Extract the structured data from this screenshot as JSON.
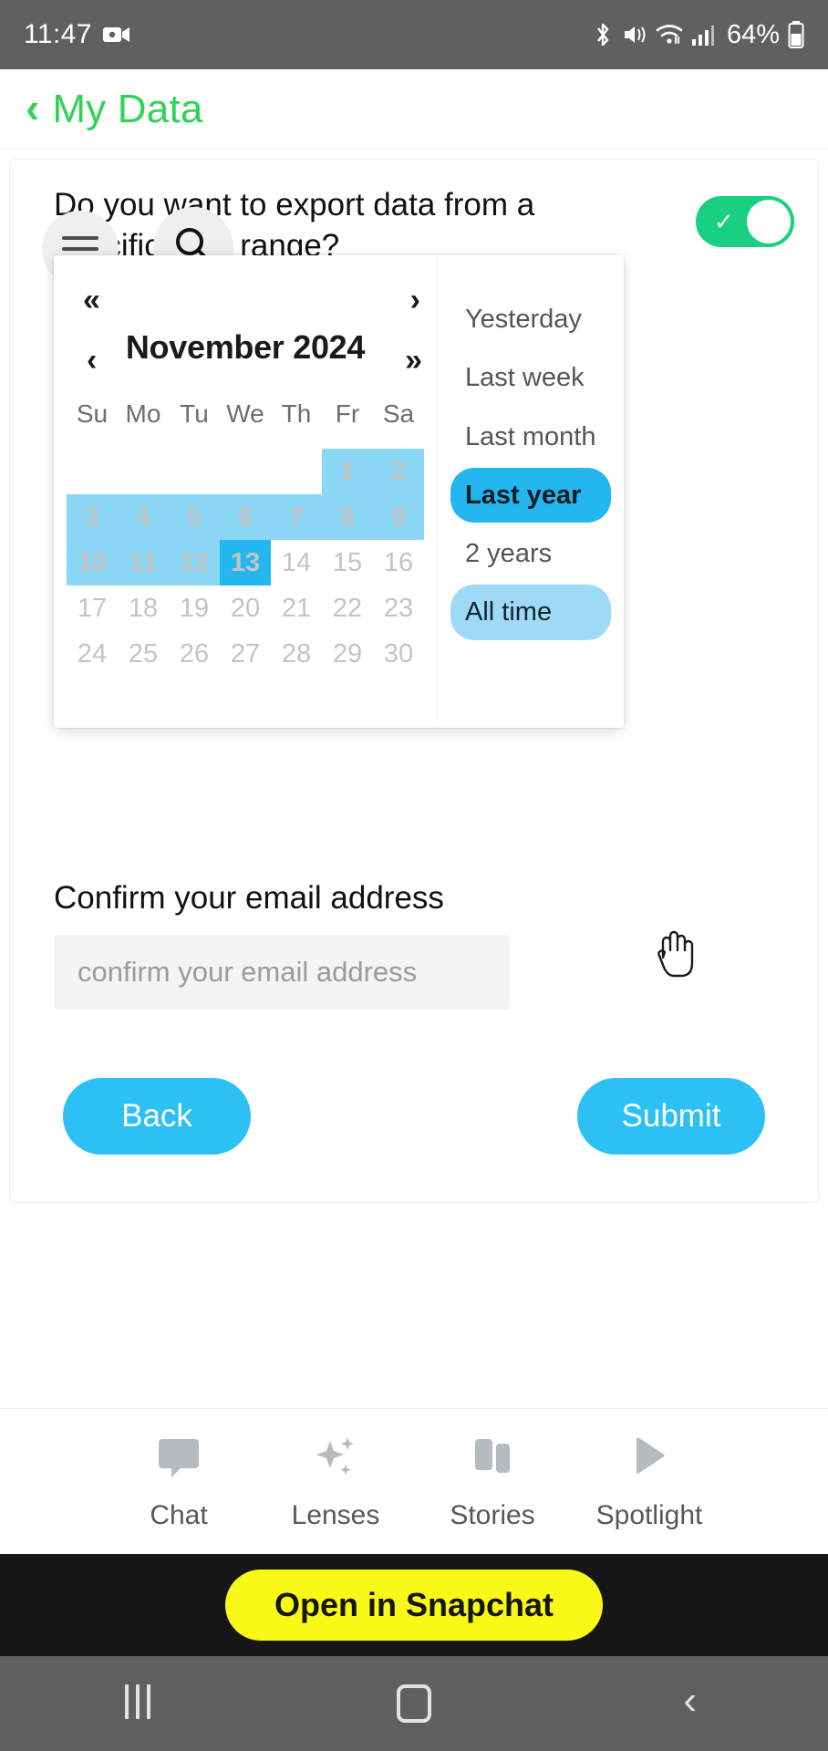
{
  "status_bar": {
    "time": "11:47",
    "battery_percent": "64%",
    "icons": [
      "screen-recorder-icon",
      "bluetooth-icon",
      "mute-icon",
      "wifi-icon",
      "cellular-signal-icon",
      "battery-icon"
    ]
  },
  "titlebar": {
    "back_label": "‹",
    "title": "My Data",
    "accent_color": "#2fd455"
  },
  "overlay_buttons": {
    "menu": "menu-icon",
    "search": "search-icon"
  },
  "form": {
    "question": "Do you want to export data from a specific date range?",
    "toggle_on": true,
    "toggle_color": "#18d07f",
    "email_label": "Confirm your email address",
    "email_value": "",
    "email_placeholder": "confirm your email address",
    "back_label": "Back",
    "submit_label": "Submit",
    "button_color": "#2cc0f5"
  },
  "datepicker": {
    "title": "November 2024",
    "nav": {
      "prev_year": "«",
      "prev_month": "‹",
      "next_month": "›",
      "next_year": "»"
    },
    "weekdays": [
      "Su",
      "Mo",
      "Tu",
      "We",
      "Th",
      "Fr",
      "Sa"
    ],
    "weeks": [
      [
        {
          "day": "",
          "state": "empty"
        },
        {
          "day": "",
          "state": "empty"
        },
        {
          "day": "",
          "state": "empty"
        },
        {
          "day": "",
          "state": "empty"
        },
        {
          "day": "",
          "state": "empty"
        },
        {
          "day": "1",
          "state": "inrange"
        },
        {
          "day": "2",
          "state": "inrange"
        }
      ],
      [
        {
          "day": "3",
          "state": "inrange"
        },
        {
          "day": "4",
          "state": "inrange"
        },
        {
          "day": "5",
          "state": "inrange"
        },
        {
          "day": "6",
          "state": "inrange"
        },
        {
          "day": "7",
          "state": "inrange"
        },
        {
          "day": "8",
          "state": "inrange"
        },
        {
          "day": "9",
          "state": "inrange"
        }
      ],
      [
        {
          "day": "10",
          "state": "inrange"
        },
        {
          "day": "11",
          "state": "inrange"
        },
        {
          "day": "12",
          "state": "inrange"
        },
        {
          "day": "13",
          "state": "selected"
        },
        {
          "day": "14",
          "state": "normal"
        },
        {
          "day": "15",
          "state": "normal"
        },
        {
          "day": "16",
          "state": "normal"
        }
      ],
      [
        {
          "day": "17",
          "state": "normal"
        },
        {
          "day": "18",
          "state": "normal"
        },
        {
          "day": "19",
          "state": "normal"
        },
        {
          "day": "20",
          "state": "normal"
        },
        {
          "day": "21",
          "state": "normal"
        },
        {
          "day": "22",
          "state": "normal"
        },
        {
          "day": "23",
          "state": "normal"
        }
      ],
      [
        {
          "day": "24",
          "state": "normal"
        },
        {
          "day": "25",
          "state": "normal"
        },
        {
          "day": "26",
          "state": "normal"
        },
        {
          "day": "27",
          "state": "normal"
        },
        {
          "day": "28",
          "state": "normal"
        },
        {
          "day": "29",
          "state": "normal"
        },
        {
          "day": "30",
          "state": "normal"
        }
      ]
    ],
    "presets": [
      {
        "label": "Yesterday",
        "state": "normal"
      },
      {
        "label": "Last week",
        "state": "normal"
      },
      {
        "label": "Last month",
        "state": "normal"
      },
      {
        "label": "Last year",
        "state": "active"
      },
      {
        "label": "2 years",
        "state": "normal"
      },
      {
        "label": "All time",
        "state": "hover"
      }
    ],
    "range_color": "#8ad8f5",
    "selected_color": "#23b6ef"
  },
  "tabbar": {
    "items": [
      {
        "label": "Chat",
        "icon": "chat-bubble-icon"
      },
      {
        "label": "Lenses",
        "icon": "sparkles-icon"
      },
      {
        "label": "Stories",
        "icon": "stories-cards-icon"
      },
      {
        "label": "Spotlight",
        "icon": "play-triangle-icon"
      }
    ]
  },
  "snapbar": {
    "label": "Open in Snapchat",
    "background": "#161616",
    "button_color": "#f8f916"
  },
  "android_nav": {
    "recents": "recents-icon",
    "home": "home-icon",
    "back": "back-icon"
  }
}
